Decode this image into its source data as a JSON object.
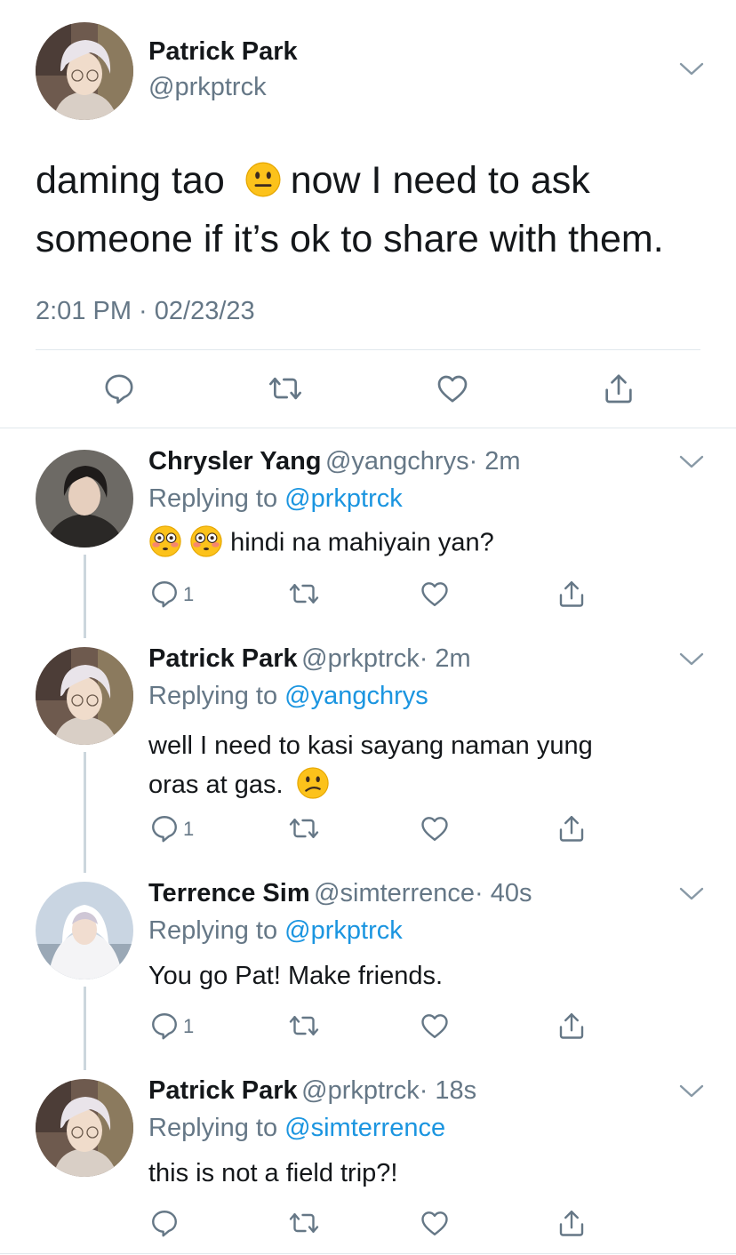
{
  "main_tweet": {
    "author_name": "Patrick Park",
    "author_handle": "@prkptrck",
    "text_line1_before": "daming tao",
    "text_line1_after": "now I need to ask",
    "text_line2": "someone if it’s ok to share with them.",
    "timestamp": "2:01 PM · 02/23/23"
  },
  "replies": [
    {
      "name": "Chrysler Yang",
      "handle": "@yangchrys",
      "time": "· 2m",
      "replying_label": "Replying to",
      "replying_to": "@prkptrck",
      "text": "hindi na mahiyain yan?",
      "reply_count": "1"
    },
    {
      "name": "Patrick Park",
      "handle": "@prkptrck",
      "time": "· 2m",
      "replying_label": "Replying to",
      "replying_to": "@yangchrys",
      "text_line1": "well I need to kasi sayang naman yung",
      "text_line2": "oras at gas.",
      "reply_count": "1"
    },
    {
      "name": "Terrence Sim",
      "handle": "@simterrence",
      "time": "· 40s",
      "replying_label": "Replying to",
      "replying_to": "@prkptrck",
      "text": "You go Pat! Make friends.",
      "reply_count": "1"
    },
    {
      "name": "Patrick Park",
      "handle": "@prkptrck",
      "time": "· 18s",
      "replying_label": "Replying to",
      "replying_to": "@simterrence",
      "text": "this is not a field trip?!"
    }
  ],
  "icons": {
    "reply": "reply-icon",
    "retweet": "retweet-icon",
    "like": "heart-icon",
    "share": "share-icon",
    "menu": "chevron-down-icon"
  },
  "colors": {
    "link": "#1b95e0",
    "muted": "#657786",
    "icon": "#657786",
    "divider": "#e1e8ed"
  }
}
